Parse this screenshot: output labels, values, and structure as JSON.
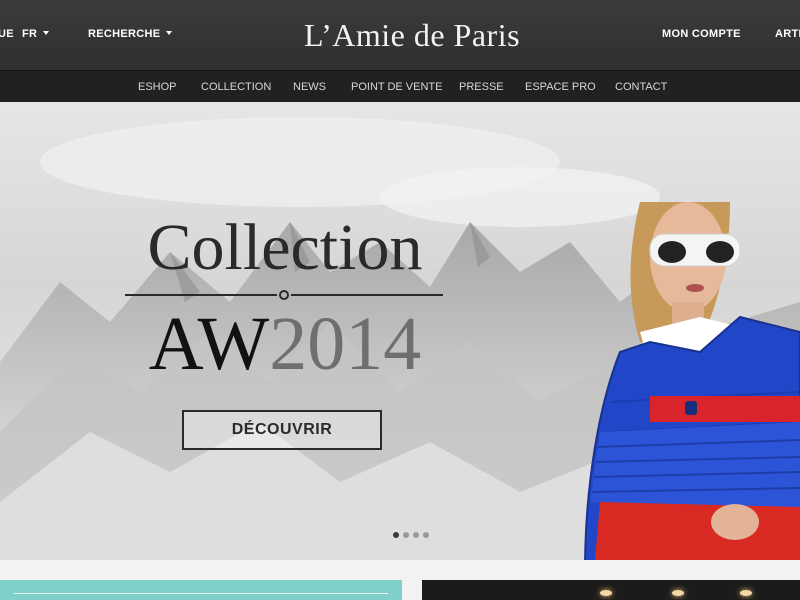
{
  "header": {
    "lang_partial": "UE",
    "lang_selected": "FR",
    "search_label": "RECHERCHE",
    "brand": "L’Amie de Paris",
    "account_label": "MON COMPTE",
    "cart_partial": "ARTI"
  },
  "nav": {
    "items": [
      "ESHOP",
      "COLLECTION",
      "NEWS",
      "POINT DE VENTE",
      "PRESSE",
      "ESPACE PRO",
      "CONTACT"
    ]
  },
  "hero": {
    "title": "Collection",
    "subtitle_aw": "AW",
    "subtitle_year": "2014",
    "cta_label": "DÉCOUVRIR",
    "slides_count": 4,
    "active_slide": 1
  },
  "colors": {
    "topbar": "#333436",
    "navbar": "#202122",
    "jacket": "#2246c8",
    "belt": "#d8242a",
    "tile_teal": "#7fcfcb",
    "tile_dark": "#1c1b1b"
  }
}
